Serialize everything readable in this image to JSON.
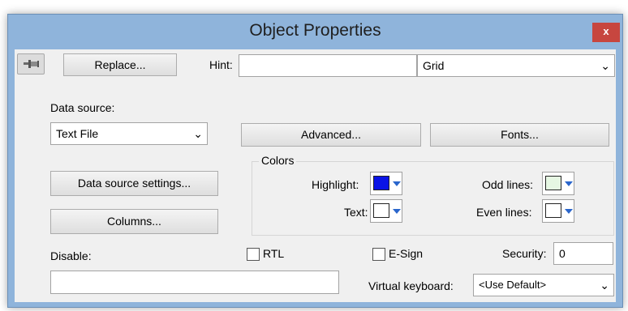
{
  "window": {
    "title": "Object Properties",
    "close_label": "x"
  },
  "toolbar": {
    "pin_icon": "pin-icon",
    "replace_label": "Replace...",
    "hint_label": "Hint:",
    "hint_value": "",
    "object_type": "Grid"
  },
  "data_source": {
    "label": "Data source:",
    "value": "Text File",
    "advanced_label": "Advanced...",
    "fonts_label": "Fonts...",
    "settings_label": "Data source settings...",
    "columns_label": "Columns..."
  },
  "colors": {
    "group_title": "Colors",
    "highlight_label": "Highlight:",
    "highlight_color": "#0a14e6",
    "text_label": "Text:",
    "text_color": "#ffffff",
    "odd_lines_label": "Odd lines:",
    "odd_lines_color": "#e6f7e3",
    "even_lines_label": "Even lines:",
    "even_lines_color": "#ffffff"
  },
  "options": {
    "disable_label": "Disable:",
    "disable_value": "",
    "rtl_label": "RTL",
    "rtl_checked": false,
    "esign_label": "E-Sign",
    "esign_checked": false,
    "security_label": "Security:",
    "security_value": "0",
    "virtual_keyboard_label": "Virtual keyboard:",
    "virtual_keyboard_value": "<Use Default>"
  }
}
